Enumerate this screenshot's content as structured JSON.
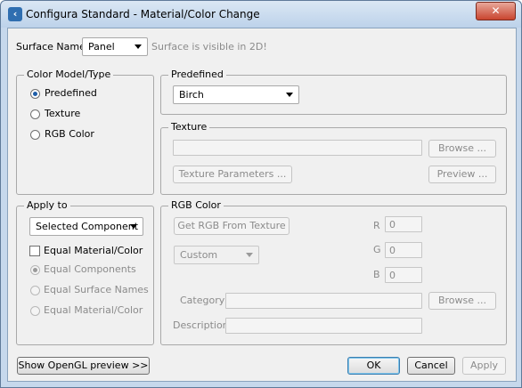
{
  "window": {
    "title": "Configura Standard - Material/Color Change",
    "close_label": "✕"
  },
  "surface": {
    "label": "Surface Name",
    "value": "Panel",
    "hint": "Surface is visible in 2D!"
  },
  "color_model": {
    "legend": "Color Model/Type",
    "options": [
      "Predefined",
      "Texture",
      "RGB Color"
    ],
    "selected": "Predefined"
  },
  "predefined": {
    "legend": "Predefined",
    "value": "Birch"
  },
  "texture": {
    "legend": "Texture",
    "browse_label": "Browse ...",
    "parameters_label": "Texture Parameters ...",
    "preview_label": "Preview ..."
  },
  "apply_to": {
    "legend": "Apply to",
    "value": "Selected Component",
    "checkbox_label": "Equal Material/Color",
    "options": [
      "Equal Components",
      "Equal Surface Names",
      "Equal Material/Color"
    ],
    "selected": "Equal Components"
  },
  "rgb": {
    "legend": "RGB Color",
    "get_label": "Get RGB From Texture",
    "mode_value": "Custom",
    "r_label": "R",
    "r_value": "0",
    "g_label": "G",
    "g_value": "0",
    "b_label": "B",
    "b_value": "0",
    "category_label": "Category",
    "category_browse_label": "Browse ...",
    "description_label": "Description"
  },
  "footer": {
    "opengl_label": "Show OpenGL preview >>",
    "ok_label": "OK",
    "cancel_label": "Cancel",
    "apply_label": "Apply"
  },
  "icons": {
    "app": "configura-app-icon",
    "close": "close-icon"
  }
}
